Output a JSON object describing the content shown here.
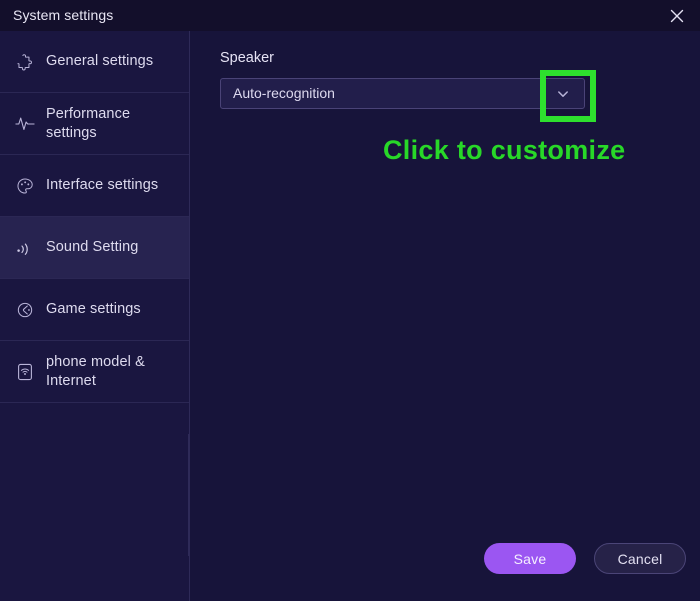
{
  "window": {
    "title": "System settings",
    "close_icon": "close-icon"
  },
  "sidebar": {
    "items": [
      {
        "label": "General settings",
        "icon": "puzzle-piece-icon",
        "selected": false
      },
      {
        "label": "Performance settings",
        "icon": "activity-pulse-icon",
        "selected": false
      },
      {
        "label": "Interface settings",
        "icon": "palette-icon",
        "selected": false
      },
      {
        "label": "Sound Setting",
        "icon": "sound-waves-icon",
        "selected": true
      },
      {
        "label": "Game settings",
        "icon": "game-controller-icon",
        "selected": false
      },
      {
        "label": "phone model & Internet",
        "icon": "phone-signal-icon",
        "selected": false
      }
    ]
  },
  "main": {
    "speaker_label": "Speaker",
    "speaker_value": "Auto-recognition",
    "dropdown_icon": "chevron-down-icon"
  },
  "annotation": {
    "text": "Click to customize",
    "color": "#28d828",
    "highlight_color": "#2ee02e"
  },
  "footer": {
    "save_label": "Save",
    "cancel_label": "Cancel",
    "save_color": "#9b56f2"
  }
}
